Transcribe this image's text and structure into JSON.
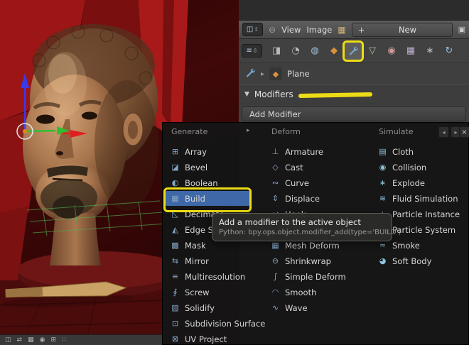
{
  "colors": {
    "annotation": "#ecdc15",
    "selection_blue": "#3e68a8"
  },
  "icons": {
    "editor_image": "◫",
    "editor_properties": "≡",
    "updown": "⇕",
    "pin": "⊖",
    "image_datablock": "▦",
    "image_small": "▣",
    "breadcrumb_chevron": "▸",
    "object_cube": "◆",
    "collapse_triangle": "▼"
  },
  "image_editor": {
    "view_menu": "View",
    "image_menu": "Image",
    "plus": "+",
    "new_button": "New"
  },
  "properties": {
    "tabs": [
      {
        "id": "render",
        "glyph": "◨",
        "color": "#b9b9b9"
      },
      {
        "id": "scene",
        "glyph": "◔",
        "color": "#b9b9b9"
      },
      {
        "id": "world",
        "glyph": "◍",
        "color": "#9fc0da"
      },
      {
        "id": "object",
        "glyph": "◆",
        "color": "#d8923a"
      },
      {
        "id": "modifiers",
        "glyph": "wrench",
        "color": "#7aa6cf",
        "highlighted": true
      },
      {
        "id": "object-data",
        "glyph": "▽",
        "color": "#a9c79b"
      },
      {
        "id": "material",
        "glyph": "◉",
        "color": "#cf9b9b"
      },
      {
        "id": "texture",
        "glyph": "▦",
        "color": "#bfb0cf"
      },
      {
        "id": "particles",
        "glyph": "∗",
        "color": "#b9b9b9"
      },
      {
        "id": "physics",
        "glyph": "↻",
        "color": "#8fc0dd"
      }
    ],
    "breadcrumb": {
      "object_label": "Plane"
    },
    "modifiers_section_title": "Modifiers",
    "add_modifier_label": "Add Modifier",
    "nav": {
      "prev": "◂",
      "next": "▸",
      "close": "×",
      "collapsed": "▸"
    }
  },
  "modifier_menu": {
    "columns": [
      {
        "title": "Generate",
        "items": [
          {
            "label": "Array",
            "icon": "⊞"
          },
          {
            "label": "Bevel",
            "icon": "◪"
          },
          {
            "label": "Boolean",
            "icon": "◐"
          },
          {
            "label": "Build",
            "icon": "▦",
            "selected": true
          },
          {
            "label": "Decimate",
            "icon": "◺"
          },
          {
            "label": "Edge Split",
            "icon": "◭"
          },
          {
            "label": "Mask",
            "icon": "▩"
          },
          {
            "label": "Mirror",
            "icon": "⇆"
          },
          {
            "label": "Multiresolution",
            "icon": "≡"
          },
          {
            "label": "Screw",
            "icon": "∮"
          },
          {
            "label": "Solidify",
            "icon": "▧"
          },
          {
            "label": "Subdivision Surface",
            "icon": "⊡"
          },
          {
            "label": "UV Project",
            "icon": "⊠"
          }
        ]
      },
      {
        "title": "Deform",
        "items": [
          {
            "label": "Armature",
            "icon": "⊥"
          },
          {
            "label": "Cast",
            "icon": "◇"
          },
          {
            "label": "Curve",
            "icon": "∾"
          },
          {
            "label": "Displace",
            "icon": "⇕"
          },
          {
            "label": "Hook",
            "icon": "↩"
          },
          {
            "label": "",
            "icon": ""
          },
          {
            "label": "Mesh Deform",
            "icon": "▦"
          },
          {
            "label": "Shrinkwrap",
            "icon": "⊖"
          },
          {
            "label": "Simple Deform",
            "icon": "∫"
          },
          {
            "label": "Smooth",
            "icon": "◠"
          },
          {
            "label": "Wave",
            "icon": "∿"
          }
        ]
      },
      {
        "title": "Simulate",
        "items": [
          {
            "label": "Cloth",
            "icon": "▤"
          },
          {
            "label": "Collision",
            "icon": "◉"
          },
          {
            "label": "Explode",
            "icon": "∗"
          },
          {
            "label": "Fluid Simulation",
            "icon": "≋"
          },
          {
            "label": "Particle Instance",
            "icon": "∴"
          },
          {
            "label": "Particle System",
            "icon": "∵"
          },
          {
            "label": "Smoke",
            "icon": "≈"
          },
          {
            "label": "Soft Body",
            "icon": "◕"
          }
        ]
      }
    ]
  },
  "tooltip": {
    "line1": "Add a modifier to the active object",
    "line2": "Python: bpy.ops.object.modifier_add(type='BUILD')"
  },
  "viewport": {
    "footer_icons": [
      "◫",
      "⇄",
      "▦",
      "◉",
      "⊞",
      "∷"
    ]
  }
}
